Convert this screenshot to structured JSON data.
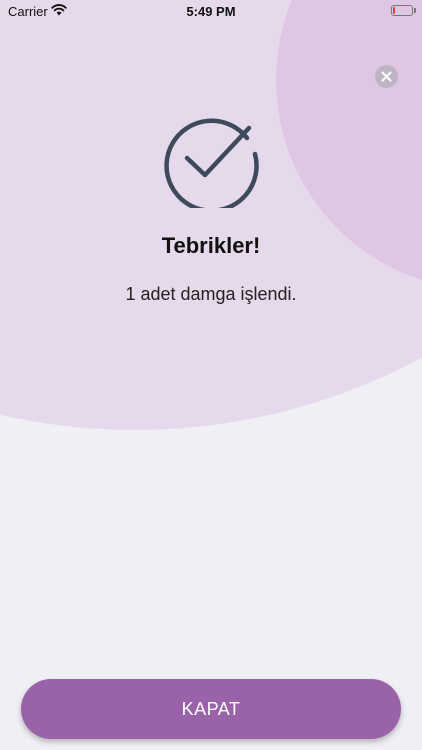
{
  "status_bar": {
    "carrier": "Carrier",
    "time": "5:49 PM",
    "battery_level": 0.1,
    "battery_color": "#e53935"
  },
  "dialog": {
    "close_icon": "close-icon",
    "success_icon": "checkmark-circle-icon",
    "title": "Tebrikler!",
    "message": "1 adet damga işlendi.",
    "primary_button_label": "KAPAT"
  },
  "colors": {
    "background": "#f1eff6",
    "accent": "#9a63a9",
    "blob_light": "#e6d9eb",
    "blob_dark": "#ddc7e2",
    "icon_stroke": "#3d4a5c"
  }
}
